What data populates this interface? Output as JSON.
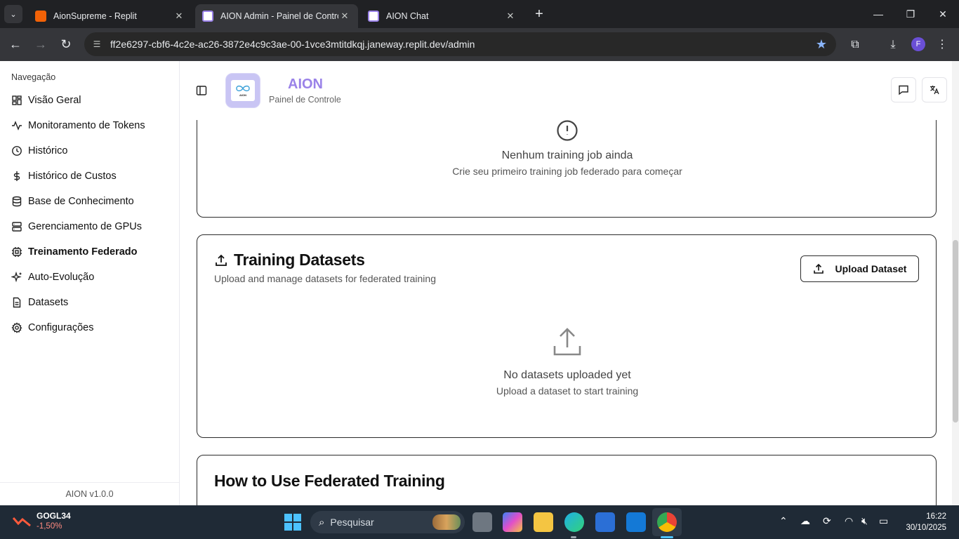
{
  "browser": {
    "tabs": [
      {
        "title": "AionSupreme - Replit",
        "favicon_color": "#f26207"
      },
      {
        "title": "AION Admin - Painel de Controle",
        "favicon_color": "#ffffff"
      },
      {
        "title": "AION Chat",
        "favicon_color": "#ffffff"
      }
    ],
    "url": "ff2e6297-cbf6-4c2e-ac26-3872e4c9c3ae-00-1vce3mtitdkqj.janeway.replit.dev/admin",
    "profile_initial": "F"
  },
  "sidebar": {
    "heading": "Navegação",
    "items": [
      {
        "label": "Visão Geral",
        "icon": "dashboard-icon"
      },
      {
        "label": "Monitoramento de Tokens",
        "icon": "activity-icon"
      },
      {
        "label": "Histórico",
        "icon": "clock-icon"
      },
      {
        "label": "Histórico de Custos",
        "icon": "dollar-icon"
      },
      {
        "label": "Base de Conhecimento",
        "icon": "database-icon"
      },
      {
        "label": "Gerenciamento de GPUs",
        "icon": "server-icon"
      },
      {
        "label": "Treinamento Federado",
        "icon": "cpu-icon"
      },
      {
        "label": "Auto-Evolução",
        "icon": "sparkles-icon"
      },
      {
        "label": "Datasets",
        "icon": "file-icon"
      },
      {
        "label": "Configurações",
        "icon": "gear-icon"
      }
    ],
    "active_index": 6,
    "version": "AION v1.0.0"
  },
  "header": {
    "logo_text": "AION",
    "title": "AION",
    "subtitle": "Painel de Controle"
  },
  "jobs_card": {
    "empty_title": "Nenhum training job ainda",
    "empty_sub": "Crie seu primeiro training job federado para começar"
  },
  "datasets_card": {
    "title": "Training Datasets",
    "description": "Upload and manage datasets for federated training",
    "upload_button": "Upload Dataset",
    "empty_title": "No datasets uploaded yet",
    "empty_sub": "Upload a dataset to start training"
  },
  "howto_card": {
    "title": "How to Use Federated Training"
  },
  "taskbar": {
    "stock_symbol": "GOGL34",
    "stock_change": "-1,50%",
    "search_placeholder": "Pesquisar",
    "time": "16:22",
    "date": "30/10/2025"
  },
  "colors": {
    "accent": "#9a82e8",
    "logo_bg": "#c9c5f4",
    "card_border": "#2b2b2b",
    "taskbar": "#1f2a36"
  }
}
